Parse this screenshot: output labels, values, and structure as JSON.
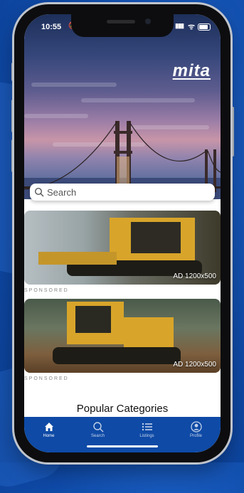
{
  "status_bar": {
    "time": "10:55"
  },
  "brand": {
    "logo_text": "mita"
  },
  "search": {
    "placeholder": "Search"
  },
  "ads": [
    {
      "label": "AD 1200x500",
      "sponsored": "SPONSORED"
    },
    {
      "label": "AD 1200x500",
      "sponsored": "SPONSORED"
    }
  ],
  "sections": {
    "popular_title": "Popular Categories"
  },
  "tabs": [
    {
      "label": "Home",
      "icon": "home-icon"
    },
    {
      "label": "Search",
      "icon": "search-icon"
    },
    {
      "label": "Listings",
      "icon": "list-icon"
    },
    {
      "label": "Profile",
      "icon": "profile-icon"
    }
  ],
  "colors": {
    "accent": "#0e4aa6",
    "background": "#0f4aa8"
  }
}
